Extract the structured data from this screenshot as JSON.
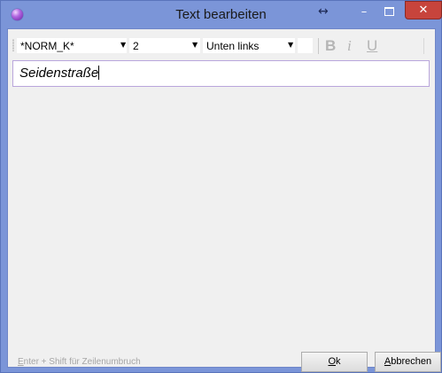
{
  "window": {
    "title": "Text bearbeiten",
    "resize_icon": "↔",
    "minimize_glyph": "–",
    "close_glyph": "✕"
  },
  "toolbar": {
    "font": {
      "value": "*NORM_K*",
      "arrow": "▼"
    },
    "size": {
      "value": "2",
      "arrow": "▼"
    },
    "alignment": {
      "value": "Unten links",
      "arrow": "▼"
    },
    "bold_label": "B",
    "italic_label": "i",
    "underline_label": "U"
  },
  "editor": {
    "value": "Seidenstraße"
  },
  "footer": {
    "hint_mnemonic": "E",
    "hint_rest": "nter + Shift für Zeilenumbruch",
    "ok_mnemonic": "O",
    "ok_rest": "k",
    "cancel_mnemonic": "A",
    "cancel_rest": "bbrechen"
  },
  "colors": {
    "titlebar": "#7b95d8",
    "close_button": "#c7443c",
    "client_background": "#f0f0f0",
    "editor_border": "#b9a6dc",
    "disabled_format": "#b5b5b5"
  }
}
